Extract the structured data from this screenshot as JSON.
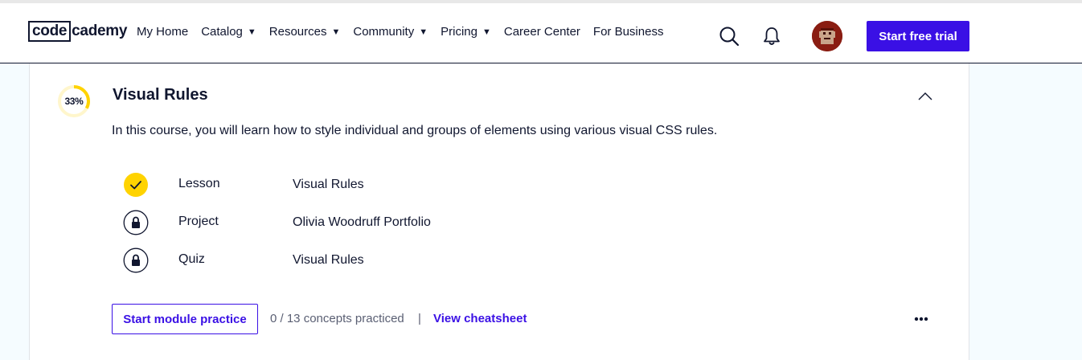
{
  "header": {
    "logo_part1": "code",
    "logo_part2": "cademy",
    "nav": [
      {
        "label": "My Home",
        "dropdown": false
      },
      {
        "label": "Catalog",
        "dropdown": true
      },
      {
        "label": "Resources",
        "dropdown": true
      },
      {
        "label": "Community",
        "dropdown": true
      },
      {
        "label": "Pricing",
        "dropdown": true
      },
      {
        "label": "Career Center",
        "dropdown": false
      },
      {
        "label": "For Business",
        "dropdown": false
      }
    ],
    "dropdown_glyph": "▼",
    "icons": {
      "search": "search-icon",
      "notifications": "bell-icon",
      "avatar": "user-avatar"
    },
    "cta_label": "Start free trial"
  },
  "module": {
    "progress_label": "33%",
    "progress_fraction": 0.33,
    "title": "Visual Rules",
    "collapse_icon": "chevron-up-icon",
    "description": "In this course, you will learn how to style individual and groups of elements using various visual CSS rules.",
    "items": [
      {
        "type": "Lesson",
        "name": "Visual Rules",
        "status": "completed"
      },
      {
        "type": "Project",
        "name": "Olivia Woodruff Portfolio",
        "status": "locked"
      },
      {
        "type": "Quiz",
        "name": "Visual Rules",
        "status": "locked"
      }
    ],
    "practice_button": "Start module practice",
    "concepts_text": "0 / 13 concepts practiced",
    "separator": "|",
    "cheatsheet_link": "View cheatsheet",
    "more_icon": "more-options-icon"
  },
  "colors": {
    "brand": "#3a10e5",
    "progress": "#ffd300",
    "progress_track": "#fff6cc",
    "text": "#10162f",
    "avatar_bg": "#8a1d12"
  }
}
